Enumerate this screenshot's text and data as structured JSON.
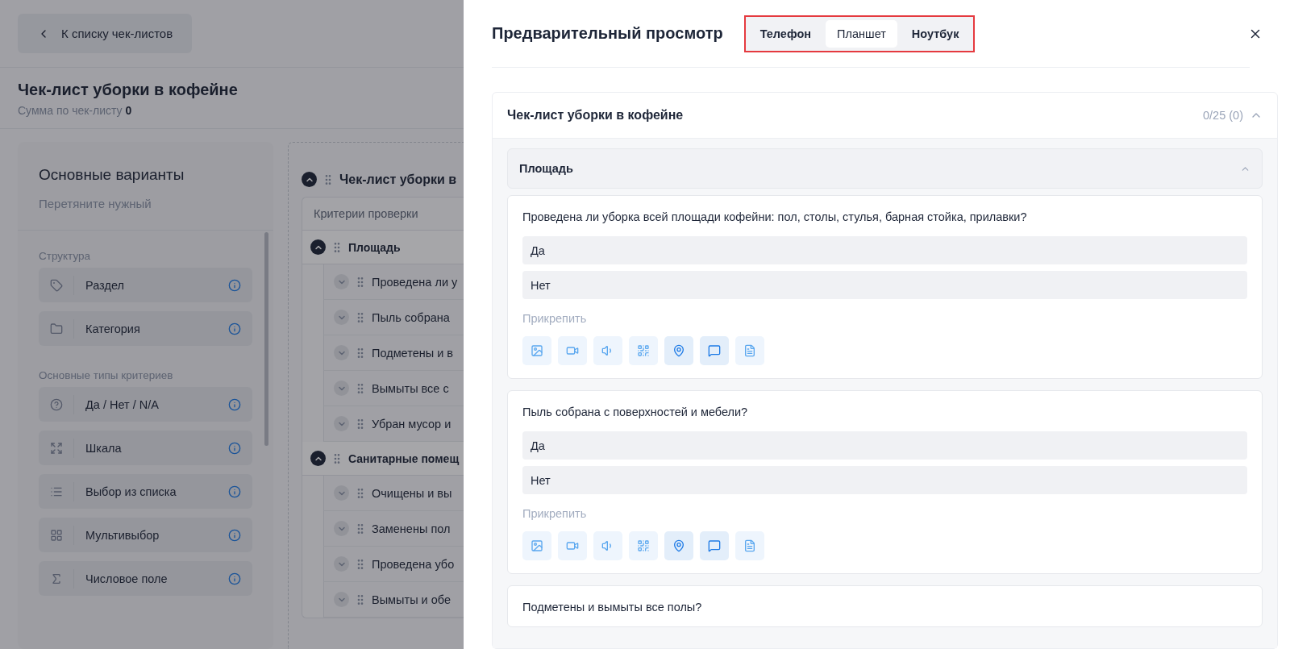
{
  "back_button": {
    "label": "К списку чек-листов"
  },
  "page": {
    "title": "Чек-лист уборки в кофейне",
    "sum_label": "Сумма по чек-листу",
    "sum_value": "0"
  },
  "palette": {
    "title": "Основные варианты",
    "subtitle": "Перетяните нужный",
    "groups": [
      {
        "label": "Структура",
        "items": [
          {
            "label": "Раздел"
          },
          {
            "label": "Категория"
          }
        ]
      },
      {
        "label": "Основные типы критериев",
        "items": [
          {
            "label": "Да / Нет / N/A"
          },
          {
            "label": "Шкала"
          },
          {
            "label": "Выбор из списка"
          },
          {
            "label": "Мультивыбор"
          },
          {
            "label": "Числовое поле"
          }
        ]
      }
    ]
  },
  "builder": {
    "root": {
      "title": "Чек-лист уборки в",
      "expanded": true
    },
    "column_header": "Критерии проверки",
    "sections": [
      {
        "title": "Площадь",
        "expanded": true,
        "items": [
          {
            "title": "Проведена ли у",
            "expanded": false
          },
          {
            "title": "Пыль собрана",
            "expanded": false
          },
          {
            "title": "Подметены и в",
            "expanded": false
          },
          {
            "title": "Вымыты все с",
            "expanded": false
          },
          {
            "title": "Убран мусор и",
            "expanded": false
          }
        ]
      },
      {
        "title": "Санитарные помещ",
        "expanded": true,
        "items": [
          {
            "title": "Очищены и вы",
            "expanded": false
          },
          {
            "title": "Заменены пол",
            "expanded": false
          },
          {
            "title": "Проведена убо",
            "expanded": false
          },
          {
            "title": "Вымыты и обе",
            "expanded": false
          }
        ]
      }
    ]
  },
  "preview": {
    "title": "Предварительный просмотр",
    "tabs": [
      {
        "label": "Телефон",
        "selected": false
      },
      {
        "label": "Планшет",
        "selected": true
      },
      {
        "label": "Ноутбук",
        "selected": false
      }
    ],
    "checklist": {
      "title": "Чек-лист уборки в кофейне",
      "score": "0/25 (0)",
      "expanded": true,
      "section": {
        "title": "Площадь",
        "expanded": true
      },
      "questions": [
        {
          "text": "Проведена ли уборка всей площади кофейни: пол, столы, стулья, барная стойка, прилавки?",
          "options": [
            "Да",
            "Нет"
          ],
          "attach_label": "Прикрепить",
          "attachments": [
            {
              "kind": "photo",
              "active": false
            },
            {
              "kind": "video",
              "active": false
            },
            {
              "kind": "audio",
              "active": false
            },
            {
              "kind": "qr",
              "active": false
            },
            {
              "kind": "location",
              "active": true
            },
            {
              "kind": "comment",
              "active": true
            },
            {
              "kind": "file",
              "active": false
            }
          ]
        },
        {
          "text": "Пыль собрана с поверхностей и мебели?",
          "options": [
            "Да",
            "Нет"
          ],
          "attach_label": "Прикрепить",
          "attachments": [
            {
              "kind": "photo",
              "active": false
            },
            {
              "kind": "video",
              "active": false
            },
            {
              "kind": "audio",
              "active": false
            },
            {
              "kind": "qr",
              "active": false
            },
            {
              "kind": "location",
              "active": true
            },
            {
              "kind": "comment",
              "active": true
            },
            {
              "kind": "file",
              "active": false
            }
          ]
        },
        {
          "text": "Подметены и вымыты все полы?"
        }
      ]
    }
  }
}
